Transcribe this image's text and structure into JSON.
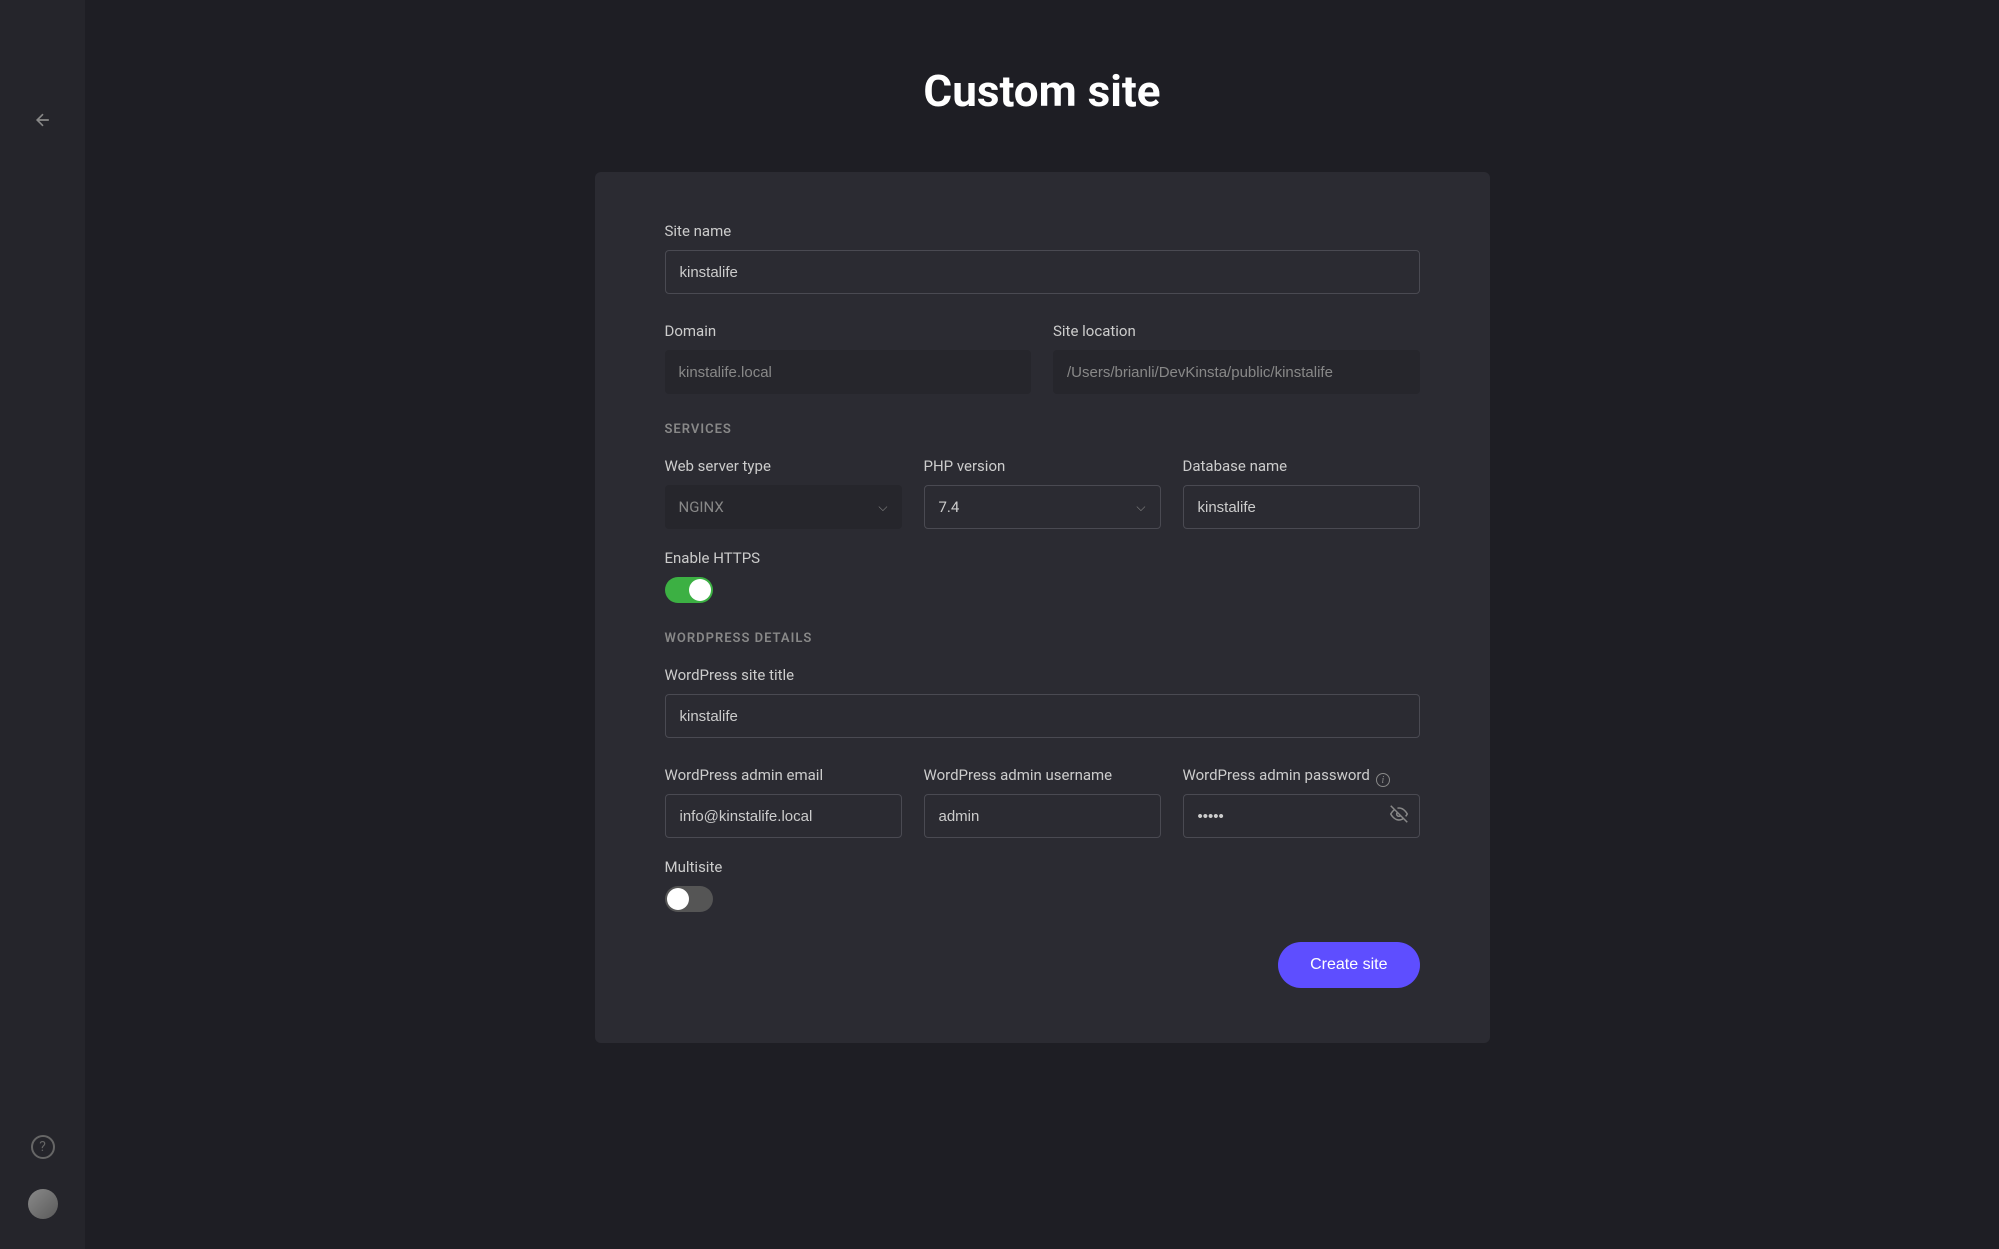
{
  "page_title": "Custom site",
  "form": {
    "site_name": {
      "label": "Site name",
      "value": "kinstalife"
    },
    "domain": {
      "label": "Domain",
      "value": "kinstalife.local"
    },
    "site_location": {
      "label": "Site location",
      "value": "/Users/brianli/DevKinsta/public/kinstalife"
    }
  },
  "services": {
    "header": "SERVICES",
    "web_server_type": {
      "label": "Web server type",
      "value": "NGINX"
    },
    "php_version": {
      "label": "PHP version",
      "value": "7.4"
    },
    "database_name": {
      "label": "Database name",
      "value": "kinstalife"
    },
    "enable_https": {
      "label": "Enable HTTPS",
      "on": true
    }
  },
  "wordpress": {
    "header": "WORDPRESS DETAILS",
    "site_title": {
      "label": "WordPress site title",
      "value": "kinstalife"
    },
    "admin_email": {
      "label": "WordPress admin email",
      "value": "info@kinstalife.local"
    },
    "admin_username": {
      "label": "WordPress admin username",
      "value": "admin"
    },
    "admin_password": {
      "label": "WordPress admin password",
      "value": "•••••"
    },
    "multisite": {
      "label": "Multisite",
      "on": false
    }
  },
  "actions": {
    "create": "Create site"
  }
}
